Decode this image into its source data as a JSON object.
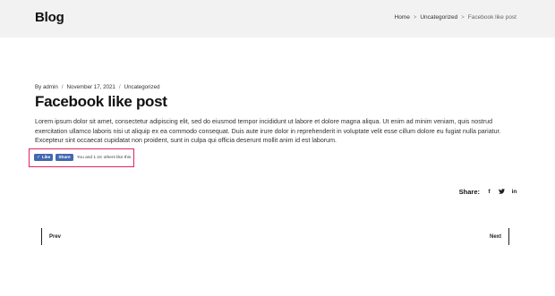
{
  "header": {
    "site_title": "Blog",
    "breadcrumb": {
      "home": "Home",
      "separator": ">",
      "category": "Uncategorized",
      "current": "Facebook like post"
    }
  },
  "post": {
    "meta": {
      "author_prefix": "By admin",
      "separator": "/",
      "date": "November 17, 2021",
      "category": "Uncategorized"
    },
    "title": "Facebook like post",
    "content": "Lorem ipsum dolor sit amet, consectetur adipiscing elit, sed do eiusmod tempor incididunt ut labore et dolore magna aliqua. Ut enim ad minim veniam, quis nostrud exercitation ullamco laboris nisi ut aliquip ex ea commodo consequat. Duis aute irure dolor in reprehenderit in voluptate velit esse cillum dolore eu fugiat nulla pariatur. Excepteur sint occaecat cupidatat non proident, sunt in culpa qui officia deserunt mollit anim id est laborum."
  },
  "facebook_widget": {
    "like_label": "Like",
    "share_label": "Share",
    "count_text": "You and 1.1K others like this",
    "brand_color": "#4267b2",
    "highlight_color": "#e0245e"
  },
  "share": {
    "label": "Share:",
    "icons": {
      "facebook": "f",
      "twitter": "t",
      "linkedin": "in"
    }
  },
  "post_navigation": {
    "prev_label": "Prev",
    "next_label": "Next"
  }
}
